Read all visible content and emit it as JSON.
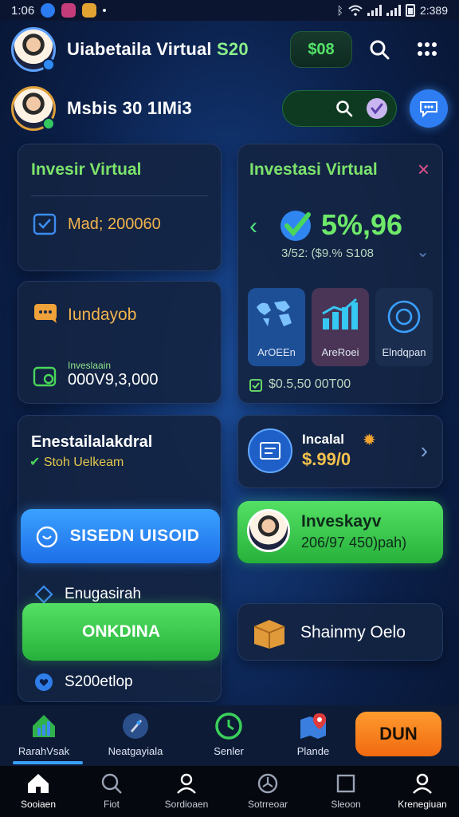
{
  "status": {
    "time": "1:06",
    "battery": "2:389"
  },
  "header": {
    "title": "Uiabetaila Virtual",
    "title_accent": "S20",
    "pill": "$08"
  },
  "user_row": {
    "name": "Msbis 30 1IMi3"
  },
  "card_left1": {
    "title": "Invesir Virtual",
    "value": "Mad; 200060"
  },
  "card_right1": {
    "title": "Investasi Virtual",
    "percent": "5%,96",
    "sub": "3/52: ($9.% S108",
    "close": "×"
  },
  "card_left2": {
    "title": "Iundayob",
    "small_label": "Inveslaain",
    "amount": "000V9,3,000"
  },
  "tiles": [
    {
      "label": "ArOEEn",
      "icon": "world-map-icon"
    },
    {
      "label": "AreRoei",
      "icon": "bar-chart-icon"
    },
    {
      "label": "Elndqpan",
      "icon": "target-icon"
    }
  ],
  "card_right2_footer": "$0.5,50 00T00",
  "card_left3": {
    "title": "Enestailalakdral",
    "check_text": "Stoh Uelkeam"
  },
  "btn_blue": "SISEDN UISOID",
  "card_right3": {
    "title": "Incalal",
    "amount": "$.99/0"
  },
  "invest_btn": {
    "title": "Inveskayv",
    "sub": "206/97 450)pah)"
  },
  "left_list": {
    "item1": "Enugasirah",
    "item2": "S200etlop"
  },
  "btn_green": "ONKDINA",
  "card_box": {
    "label": "Shainmy Oelo"
  },
  "bottom_items": [
    {
      "label": "RarahVsak",
      "icon": "home-chart-icon"
    },
    {
      "label": "Neatgayiala",
      "icon": "rocket-icon"
    },
    {
      "label": "Senler",
      "icon": "clock-icon"
    },
    {
      "label": "Plande",
      "icon": "map-pin-icon"
    }
  ],
  "buy_button": "DUN",
  "nav_items": [
    {
      "label": "Sooiaen",
      "icon": "home-icon"
    },
    {
      "label": "Fiot",
      "icon": "search-icon"
    },
    {
      "label": "Sordioaen",
      "icon": "person-icon"
    },
    {
      "label": "Sotrreoar",
      "icon": "settings-icon"
    },
    {
      "label": "Sleoon",
      "icon": "square-icon"
    },
    {
      "label": "Krenegiuan",
      "icon": "profile-icon"
    }
  ]
}
